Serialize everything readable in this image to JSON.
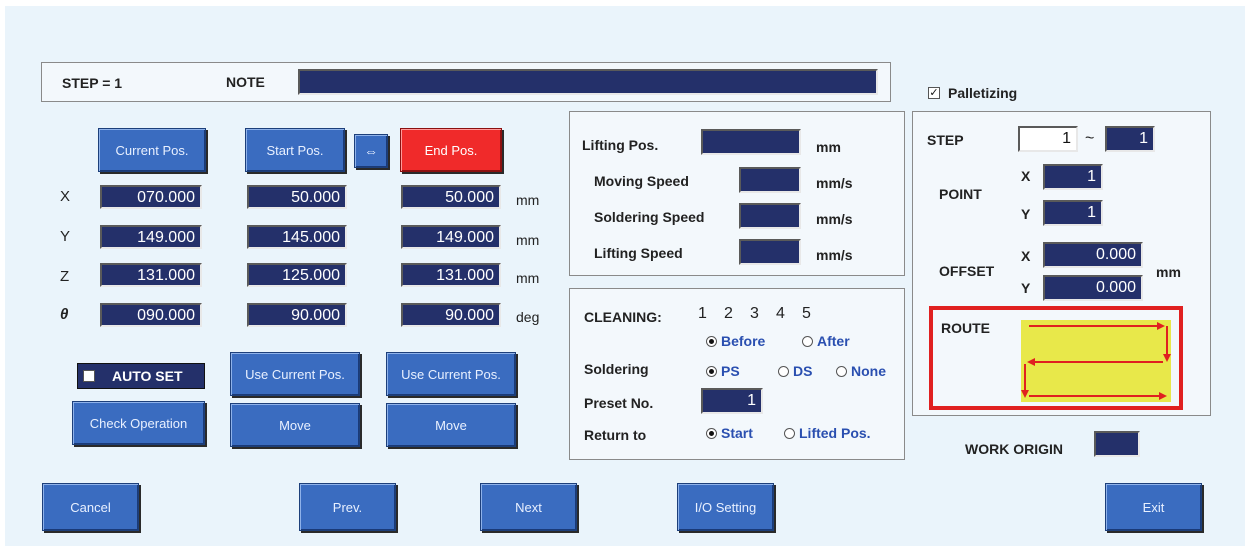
{
  "header": {
    "step_label": "STEP = 1",
    "note_label": "NOTE",
    "note_value": ""
  },
  "palletizing": {
    "label": "Palletizing",
    "checked": true
  },
  "position": {
    "current_pos_button": "Current Pos.",
    "start_pos_button": "Start Pos.",
    "swap_symbol": "⇔",
    "end_pos_button": "End Pos.",
    "rows": [
      {
        "axis": "X",
        "current": "070.000",
        "start": "50.000",
        "end": "50.000",
        "unit": "mm"
      },
      {
        "axis": "Y",
        "current": "149.000",
        "start": "145.000",
        "end": "149.000",
        "unit": "mm"
      },
      {
        "axis": "Z",
        "current": "131.000",
        "start": "125.000",
        "end": "131.000",
        "unit": "mm"
      },
      {
        "axis": "θ",
        "current": "090.000",
        "start": "90.000",
        "end": "90.000",
        "unit": "deg"
      }
    ],
    "auto_set_label": "AUTO SET",
    "use_current_start": "Use Current Pos.",
    "use_current_end": "Use Current Pos.",
    "check_operation": "Check Operation",
    "move_start": "Move",
    "move_end": "Move"
  },
  "lifting": {
    "lifting_pos_label": "Lifting Pos.",
    "lifting_pos_unit": "mm",
    "lifting_pos_value": "",
    "moving_speed_label": "Moving Speed",
    "moving_speed_unit": "mm/s",
    "moving_speed_value": "",
    "soldering_speed_label": "Soldering Speed",
    "soldering_speed_unit": "mm/s",
    "soldering_speed_value": "",
    "lifting_speed_label": "Lifting Speed",
    "lifting_speed_unit": "mm/s",
    "lifting_speed_value": ""
  },
  "cleaning": {
    "label": "CLEANING:",
    "numbers": [
      "1",
      "2",
      "3",
      "4",
      "5"
    ],
    "before": "Before",
    "after": "After",
    "selected": "Before",
    "soldering_label": "Soldering",
    "ps": "PS",
    "ds": "DS",
    "none": "None",
    "soldering_selected": "PS",
    "preset_label": "Preset No.",
    "preset_value": "1",
    "return_label": "Return to",
    "start": "Start",
    "lifted": "Lifted Pos.",
    "return_selected": "Start"
  },
  "pallet": {
    "step_label": "STEP",
    "step_from": "1",
    "tilde": "~",
    "step_to": "1",
    "point_label": "POINT",
    "point_x_label": "X",
    "point_x": "1",
    "point_y_label": "Y",
    "point_y": "1",
    "offset_label": "OFFSET",
    "offset_x_label": "X",
    "offset_x": "0.000",
    "offset_y_label": "Y",
    "offset_y": "0.000",
    "offset_unit": "mm",
    "route_label": "ROUTE"
  },
  "work_origin": {
    "label": "WORK ORIGIN",
    "value": ""
  },
  "footer": {
    "cancel": "Cancel",
    "prev": "Prev.",
    "next": "Next",
    "io_setting": "I/O Setting",
    "exit": "Exit"
  },
  "colors": {
    "background": "#eaf4fb",
    "button": "#3a6cc0",
    "end_button": "#f02a2a",
    "field": "#24306a",
    "route_fill": "#e8e84a",
    "route_border": "#e02020"
  }
}
